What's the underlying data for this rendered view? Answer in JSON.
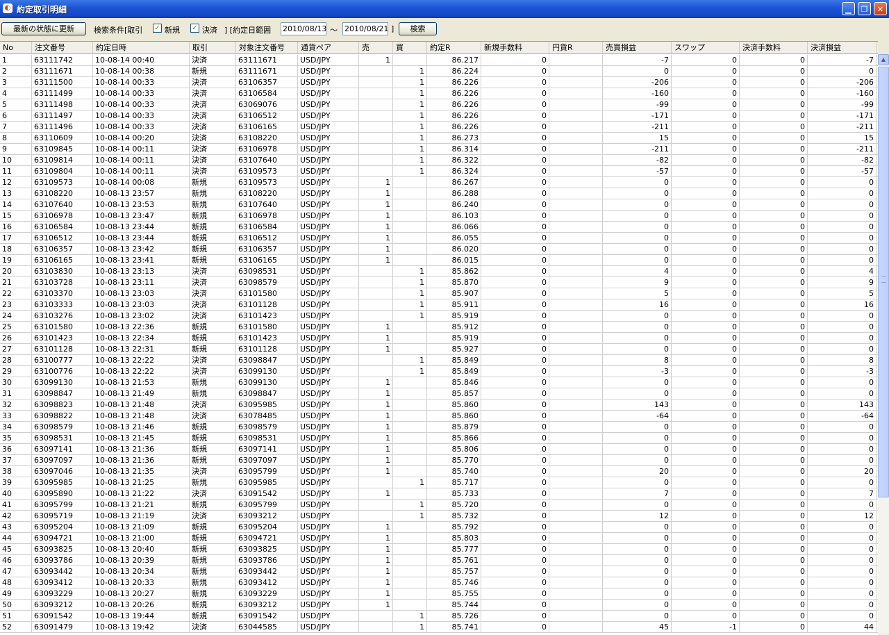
{
  "window": {
    "title": "約定取引明細",
    "icon": "app-icon"
  },
  "toolbar": {
    "refresh_label": "最新の状態に更新",
    "search_condition_label": "検索条件[取引",
    "new_label": "新規",
    "settle_label": "決済",
    "date_range_label": "] [約定日範囲",
    "date_from": "2010/08/13",
    "tilde": "～",
    "date_to": "2010/08/21",
    "bracket_close": "]",
    "search_label": "検索",
    "new_checked": true,
    "settle_checked": true
  },
  "columns": [
    "No",
    "注文番号",
    "約定日時",
    "取引",
    "対象注文番号",
    "通貨ペア",
    "売",
    "買",
    "約定R",
    "新規手数料",
    "円貨R",
    "売買損益",
    "スワップ",
    "決済手数料",
    "決済損益"
  ],
  "rows": [
    [
      "1",
      "63111742",
      "10-08-14 00:40",
      "決済",
      "63111671",
      "USD/JPY",
      "1",
      "",
      "86.217",
      "0",
      "",
      "-7",
      "0",
      "0",
      "-7"
    ],
    [
      "2",
      "63111671",
      "10-08-14 00:38",
      "新規",
      "63111671",
      "USD/JPY",
      "",
      "1",
      "86.224",
      "0",
      "",
      "0",
      "0",
      "0",
      "0"
    ],
    [
      "3",
      "63111500",
      "10-08-14 00:33",
      "決済",
      "63106357",
      "USD/JPY",
      "",
      "1",
      "86.226",
      "0",
      "",
      "-206",
      "0",
      "0",
      "-206"
    ],
    [
      "4",
      "63111499",
      "10-08-14 00:33",
      "決済",
      "63106584",
      "USD/JPY",
      "",
      "1",
      "86.226",
      "0",
      "",
      "-160",
      "0",
      "0",
      "-160"
    ],
    [
      "5",
      "63111498",
      "10-08-14 00:33",
      "決済",
      "63069076",
      "USD/JPY",
      "",
      "1",
      "86.226",
      "0",
      "",
      "-99",
      "0",
      "0",
      "-99"
    ],
    [
      "6",
      "63111497",
      "10-08-14 00:33",
      "決済",
      "63106512",
      "USD/JPY",
      "",
      "1",
      "86.226",
      "0",
      "",
      "-171",
      "0",
      "0",
      "-171"
    ],
    [
      "7",
      "63111496",
      "10-08-14 00:33",
      "決済",
      "63106165",
      "USD/JPY",
      "",
      "1",
      "86.226",
      "0",
      "",
      "-211",
      "0",
      "0",
      "-211"
    ],
    [
      "8",
      "63110609",
      "10-08-14 00:20",
      "決済",
      "63108220",
      "USD/JPY",
      "",
      "1",
      "86.273",
      "0",
      "",
      "15",
      "0",
      "0",
      "15"
    ],
    [
      "9",
      "63109845",
      "10-08-14 00:11",
      "決済",
      "63106978",
      "USD/JPY",
      "",
      "1",
      "86.314",
      "0",
      "",
      "-211",
      "0",
      "0",
      "-211"
    ],
    [
      "10",
      "63109814",
      "10-08-14 00:11",
      "決済",
      "63107640",
      "USD/JPY",
      "",
      "1",
      "86.322",
      "0",
      "",
      "-82",
      "0",
      "0",
      "-82"
    ],
    [
      "11",
      "63109804",
      "10-08-14 00:11",
      "決済",
      "63109573",
      "USD/JPY",
      "",
      "1",
      "86.324",
      "0",
      "",
      "-57",
      "0",
      "0",
      "-57"
    ],
    [
      "12",
      "63109573",
      "10-08-14 00:08",
      "新規",
      "63109573",
      "USD/JPY",
      "1",
      "",
      "86.267",
      "0",
      "",
      "0",
      "0",
      "0",
      "0"
    ],
    [
      "13",
      "63108220",
      "10-08-13 23:57",
      "新規",
      "63108220",
      "USD/JPY",
      "1",
      "",
      "86.288",
      "0",
      "",
      "0",
      "0",
      "0",
      "0"
    ],
    [
      "14",
      "63107640",
      "10-08-13 23:53",
      "新規",
      "63107640",
      "USD/JPY",
      "1",
      "",
      "86.240",
      "0",
      "",
      "0",
      "0",
      "0",
      "0"
    ],
    [
      "15",
      "63106978",
      "10-08-13 23:47",
      "新規",
      "63106978",
      "USD/JPY",
      "1",
      "",
      "86.103",
      "0",
      "",
      "0",
      "0",
      "0",
      "0"
    ],
    [
      "16",
      "63106584",
      "10-08-13 23:44",
      "新規",
      "63106584",
      "USD/JPY",
      "1",
      "",
      "86.066",
      "0",
      "",
      "0",
      "0",
      "0",
      "0"
    ],
    [
      "17",
      "63106512",
      "10-08-13 23:44",
      "新規",
      "63106512",
      "USD/JPY",
      "1",
      "",
      "86.055",
      "0",
      "",
      "0",
      "0",
      "0",
      "0"
    ],
    [
      "18",
      "63106357",
      "10-08-13 23:42",
      "新規",
      "63106357",
      "USD/JPY",
      "1",
      "",
      "86.020",
      "0",
      "",
      "0",
      "0",
      "0",
      "0"
    ],
    [
      "19",
      "63106165",
      "10-08-13 23:41",
      "新規",
      "63106165",
      "USD/JPY",
      "1",
      "",
      "86.015",
      "0",
      "",
      "0",
      "0",
      "0",
      "0"
    ],
    [
      "20",
      "63103830",
      "10-08-13 23:13",
      "決済",
      "63098531",
      "USD/JPY",
      "",
      "1",
      "85.862",
      "0",
      "",
      "4",
      "0",
      "0",
      "4"
    ],
    [
      "21",
      "63103728",
      "10-08-13 23:11",
      "決済",
      "63098579",
      "USD/JPY",
      "",
      "1",
      "85.870",
      "0",
      "",
      "9",
      "0",
      "0",
      "9"
    ],
    [
      "22",
      "63103370",
      "10-08-13 23:03",
      "決済",
      "63101580",
      "USD/JPY",
      "",
      "1",
      "85.907",
      "0",
      "",
      "5",
      "0",
      "0",
      "5"
    ],
    [
      "23",
      "63103333",
      "10-08-13 23:03",
      "決済",
      "63101128",
      "USD/JPY",
      "",
      "1",
      "85.911",
      "0",
      "",
      "16",
      "0",
      "0",
      "16"
    ],
    [
      "24",
      "63103276",
      "10-08-13 23:02",
      "決済",
      "63101423",
      "USD/JPY",
      "",
      "1",
      "85.919",
      "0",
      "",
      "0",
      "0",
      "0",
      "0"
    ],
    [
      "25",
      "63101580",
      "10-08-13 22:36",
      "新規",
      "63101580",
      "USD/JPY",
      "1",
      "",
      "85.912",
      "0",
      "",
      "0",
      "0",
      "0",
      "0"
    ],
    [
      "26",
      "63101423",
      "10-08-13 22:34",
      "新規",
      "63101423",
      "USD/JPY",
      "1",
      "",
      "85.919",
      "0",
      "",
      "0",
      "0",
      "0",
      "0"
    ],
    [
      "27",
      "63101128",
      "10-08-13 22:31",
      "新規",
      "63101128",
      "USD/JPY",
      "1",
      "",
      "85.927",
      "0",
      "",
      "0",
      "0",
      "0",
      "0"
    ],
    [
      "28",
      "63100777",
      "10-08-13 22:22",
      "決済",
      "63098847",
      "USD/JPY",
      "",
      "1",
      "85.849",
      "0",
      "",
      "8",
      "0",
      "0",
      "8"
    ],
    [
      "29",
      "63100776",
      "10-08-13 22:22",
      "決済",
      "63099130",
      "USD/JPY",
      "",
      "1",
      "85.849",
      "0",
      "",
      "-3",
      "0",
      "0",
      "-3"
    ],
    [
      "30",
      "63099130",
      "10-08-13 21:53",
      "新規",
      "63099130",
      "USD/JPY",
      "1",
      "",
      "85.846",
      "0",
      "",
      "0",
      "0",
      "0",
      "0"
    ],
    [
      "31",
      "63098847",
      "10-08-13 21:49",
      "新規",
      "63098847",
      "USD/JPY",
      "1",
      "",
      "85.857",
      "0",
      "",
      "0",
      "0",
      "0",
      "0"
    ],
    [
      "32",
      "63098823",
      "10-08-13 21:48",
      "決済",
      "63095985",
      "USD/JPY",
      "1",
      "",
      "85.860",
      "0",
      "",
      "143",
      "0",
      "0",
      "143"
    ],
    [
      "33",
      "63098822",
      "10-08-13 21:48",
      "決済",
      "63078485",
      "USD/JPY",
      "1",
      "",
      "85.860",
      "0",
      "",
      "-64",
      "0",
      "0",
      "-64"
    ],
    [
      "34",
      "63098579",
      "10-08-13 21:46",
      "新規",
      "63098579",
      "USD/JPY",
      "1",
      "",
      "85.879",
      "0",
      "",
      "0",
      "0",
      "0",
      "0"
    ],
    [
      "35",
      "63098531",
      "10-08-13 21:45",
      "新規",
      "63098531",
      "USD/JPY",
      "1",
      "",
      "85.866",
      "0",
      "",
      "0",
      "0",
      "0",
      "0"
    ],
    [
      "36",
      "63097141",
      "10-08-13 21:36",
      "新規",
      "63097141",
      "USD/JPY",
      "1",
      "",
      "85.806",
      "0",
      "",
      "0",
      "0",
      "0",
      "0"
    ],
    [
      "37",
      "63097097",
      "10-08-13 21:36",
      "新規",
      "63097097",
      "USD/JPY",
      "1",
      "",
      "85.770",
      "0",
      "",
      "0",
      "0",
      "0",
      "0"
    ],
    [
      "38",
      "63097046",
      "10-08-13 21:35",
      "決済",
      "63095799",
      "USD/JPY",
      "1",
      "",
      "85.740",
      "0",
      "",
      "20",
      "0",
      "0",
      "20"
    ],
    [
      "39",
      "63095985",
      "10-08-13 21:25",
      "新規",
      "63095985",
      "USD/JPY",
      "",
      "1",
      "85.717",
      "0",
      "",
      "0",
      "0",
      "0",
      "0"
    ],
    [
      "40",
      "63095890",
      "10-08-13 21:22",
      "決済",
      "63091542",
      "USD/JPY",
      "1",
      "",
      "85.733",
      "0",
      "",
      "7",
      "0",
      "0",
      "7"
    ],
    [
      "41",
      "63095799",
      "10-08-13 21:21",
      "新規",
      "63095799",
      "USD/JPY",
      "",
      "1",
      "85.720",
      "0",
      "",
      "0",
      "0",
      "0",
      "0"
    ],
    [
      "42",
      "63095719",
      "10-08-13 21:19",
      "決済",
      "63093212",
      "USD/JPY",
      "",
      "1",
      "85.732",
      "0",
      "",
      "12",
      "0",
      "0",
      "12"
    ],
    [
      "43",
      "63095204",
      "10-08-13 21:09",
      "新規",
      "63095204",
      "USD/JPY",
      "1",
      "",
      "85.792",
      "0",
      "",
      "0",
      "0",
      "0",
      "0"
    ],
    [
      "44",
      "63094721",
      "10-08-13 21:00",
      "新規",
      "63094721",
      "USD/JPY",
      "1",
      "",
      "85.803",
      "0",
      "",
      "0",
      "0",
      "0",
      "0"
    ],
    [
      "45",
      "63093825",
      "10-08-13 20:40",
      "新規",
      "63093825",
      "USD/JPY",
      "1",
      "",
      "85.777",
      "0",
      "",
      "0",
      "0",
      "0",
      "0"
    ],
    [
      "46",
      "63093786",
      "10-08-13 20:39",
      "新規",
      "63093786",
      "USD/JPY",
      "1",
      "",
      "85.761",
      "0",
      "",
      "0",
      "0",
      "0",
      "0"
    ],
    [
      "47",
      "63093442",
      "10-08-13 20:34",
      "新規",
      "63093442",
      "USD/JPY",
      "1",
      "",
      "85.757",
      "0",
      "",
      "0",
      "0",
      "0",
      "0"
    ],
    [
      "48",
      "63093412",
      "10-08-13 20:33",
      "新規",
      "63093412",
      "USD/JPY",
      "1",
      "",
      "85.746",
      "0",
      "",
      "0",
      "0",
      "0",
      "0"
    ],
    [
      "49",
      "63093229",
      "10-08-13 20:27",
      "新規",
      "63093229",
      "USD/JPY",
      "1",
      "",
      "85.755",
      "0",
      "",
      "0",
      "0",
      "0",
      "0"
    ],
    [
      "50",
      "63093212",
      "10-08-13 20:26",
      "新規",
      "63093212",
      "USD/JPY",
      "1",
      "",
      "85.744",
      "0",
      "",
      "0",
      "0",
      "0",
      "0"
    ],
    [
      "51",
      "63091542",
      "10-08-13 19:44",
      "新規",
      "63091542",
      "USD/JPY",
      "",
      "1",
      "85.726",
      "0",
      "",
      "0",
      "0",
      "0",
      "0"
    ],
    [
      "52",
      "63091479",
      "10-08-13 19:42",
      "決済",
      "63044585",
      "USD/JPY",
      "",
      "1",
      "85.741",
      "0",
      "",
      "45",
      "-1",
      "0",
      "44"
    ]
  ]
}
